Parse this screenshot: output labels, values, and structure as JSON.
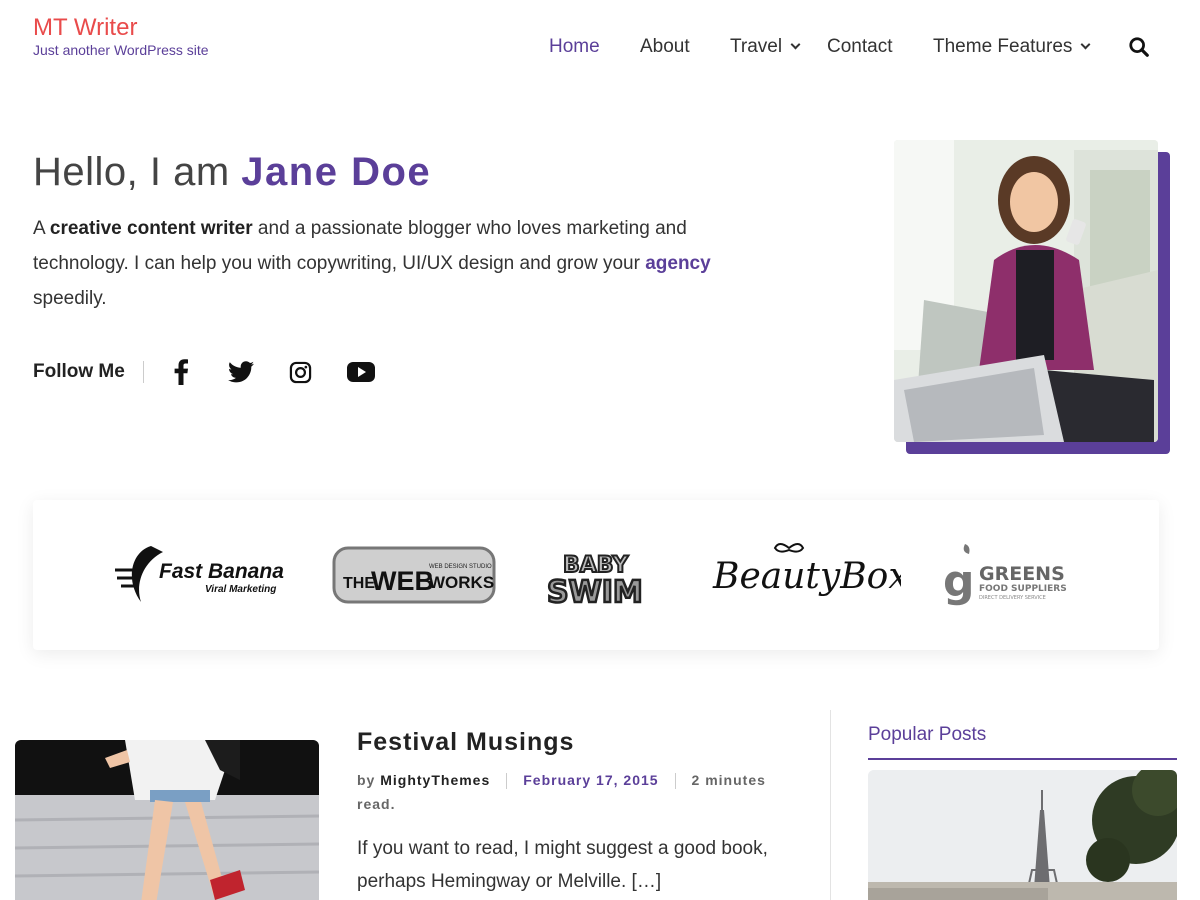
{
  "site": {
    "title": "MT Writer",
    "tagline": "Just another WordPress site"
  },
  "nav": {
    "items": [
      {
        "label": "Home",
        "active": true
      },
      {
        "label": "About"
      },
      {
        "label": "Travel",
        "dropdown": true
      },
      {
        "label": "Contact"
      },
      {
        "label": "Theme Features",
        "dropdown": true
      }
    ],
    "search_icon": "search-icon"
  },
  "hero": {
    "greeting": "Hello, I am",
    "name": "Jane Doe",
    "desc_part1": "A ",
    "desc_bold": "creative content writer",
    "desc_part2": " and a passionate blogger who loves marketing and technology. I can help you with copywriting, UI/UX design and grow your ",
    "desc_accent": "agency",
    "desc_part3": " speedily.",
    "follow_label": "Follow Me",
    "social": [
      "facebook-icon",
      "twitter-icon",
      "instagram-icon",
      "youtube-icon"
    ]
  },
  "logos": {
    "fast_banana": {
      "main": "Fast Banana",
      "sub": "Viral Marketing"
    },
    "webworks": {
      "the": "THE",
      "web": "WEB",
      "works": "WORKS",
      "studio": "WEB DESIGN STUDIO"
    },
    "babyswim": {
      "top": "BABY",
      "bottom": "SWIM"
    },
    "beautybox": {
      "text": "BeautyBox"
    },
    "greens": {
      "g": "g",
      "main": "GREENS",
      "sub": "FOOD SUPPLIERS",
      "small": "DIRECT DELIVERY SERVICE"
    }
  },
  "post": {
    "title": "Festival Musings",
    "by": "by",
    "author": "MightyThemes",
    "date": "February 17, 2015",
    "read_time": "2 minutes read.",
    "excerpt": "If you want to read, I might suggest a good book, perhaps Hemingway or Melville. […]"
  },
  "sidebar": {
    "widget_title": "Popular Posts"
  },
  "colors": {
    "accent": "#5b3f99",
    "site_title": "#e94b4b"
  }
}
